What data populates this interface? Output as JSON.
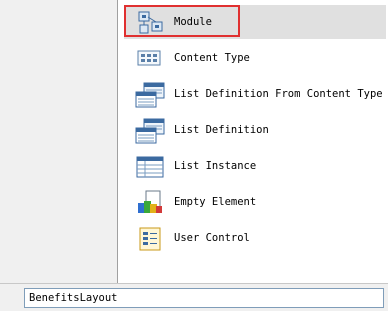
{
  "templates": [
    {
      "label": "Module",
      "icon": "module-icon",
      "selected": true
    },
    {
      "label": "Content Type",
      "icon": "content-type-icon"
    },
    {
      "label": "List Definition From Content Type",
      "icon": "list-definition-from-content-type-icon"
    },
    {
      "label": "List Definition",
      "icon": "list-definition-icon"
    },
    {
      "label": "List Instance",
      "icon": "list-instance-icon"
    },
    {
      "label": "Empty Element",
      "icon": "empty-element-icon"
    },
    {
      "label": "User Control",
      "icon": "user-control-icon"
    }
  ],
  "name_field": {
    "value": "BenefitsLayout"
  },
  "colors": {
    "highlight": "#e03030",
    "selected_bg": "#e0e0e0"
  }
}
